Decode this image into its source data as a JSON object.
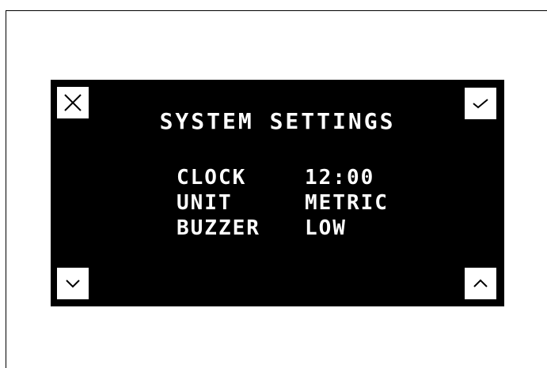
{
  "screen": {
    "title": "SYSTEM SETTINGS"
  },
  "settings": [
    {
      "label": "CLOCK",
      "value": "12:00"
    },
    {
      "label": "UNIT",
      "value": "METRIC"
    },
    {
      "label": "BUZZER",
      "value": "LOW"
    }
  ],
  "buttons": {
    "close_icon": "close-icon",
    "confirm_icon": "check-icon",
    "down_icon": "chevron-down-icon",
    "up_icon": "chevron-up-icon"
  },
  "colors": {
    "display_background": "#000000",
    "display_text": "#ffffff",
    "button_background": "#ffffff"
  }
}
